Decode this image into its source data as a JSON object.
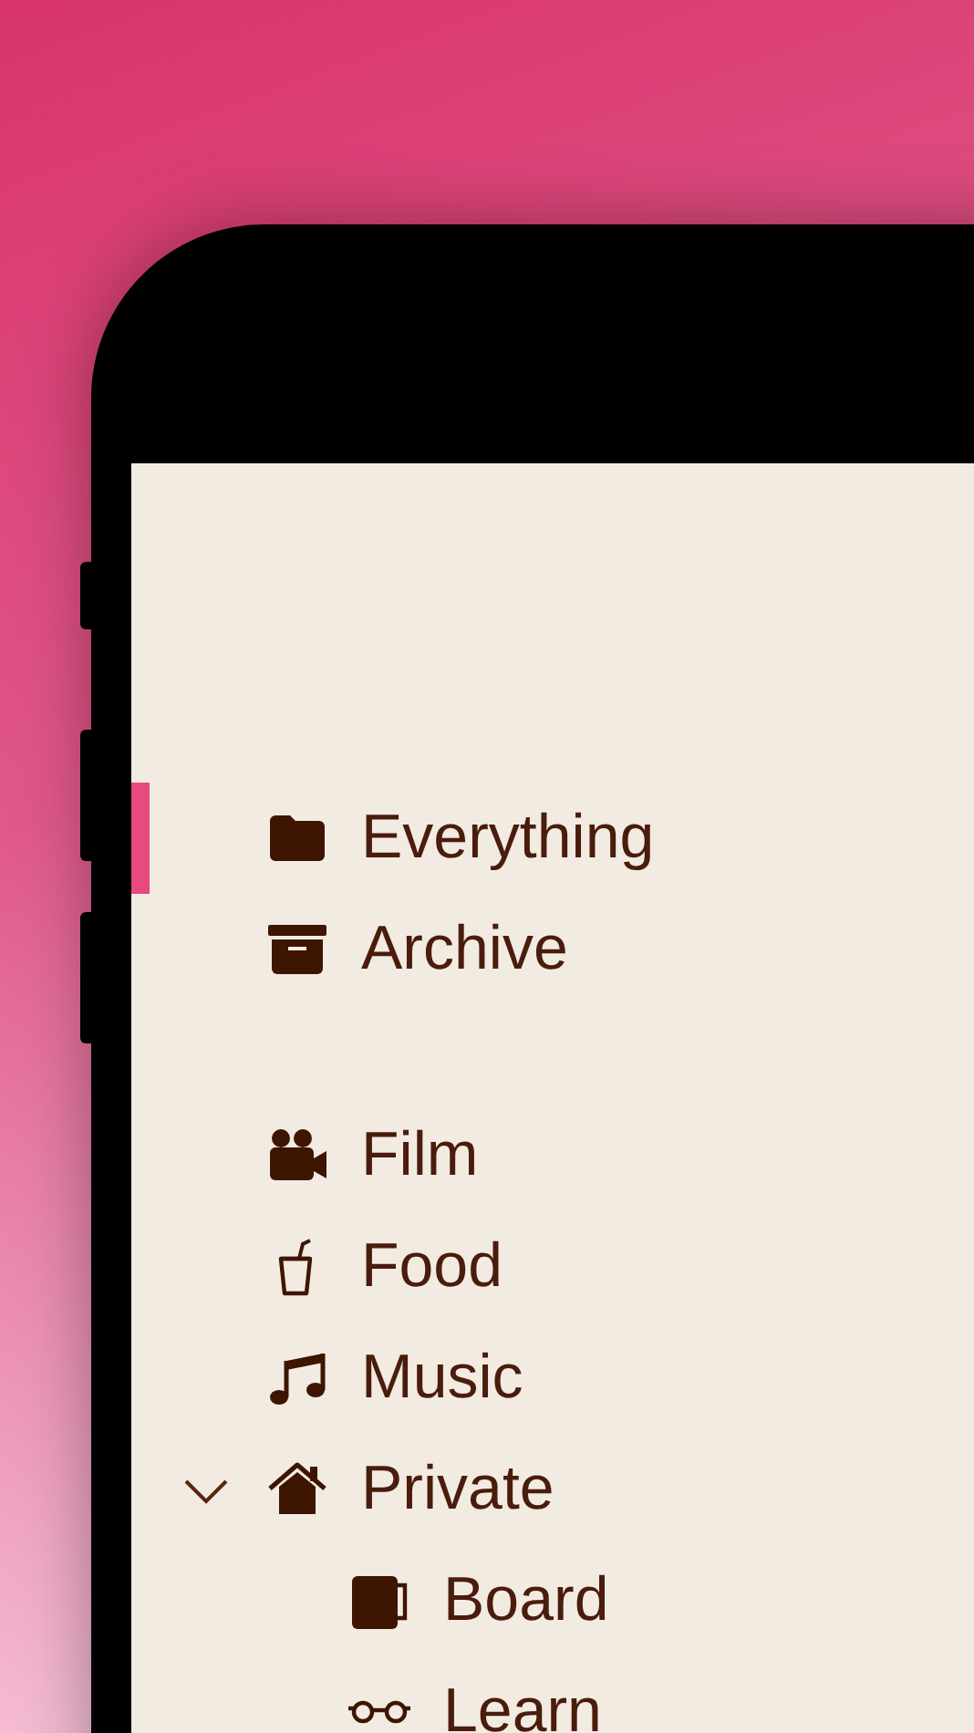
{
  "sections": [
    {
      "items": [
        {
          "label": "Everything",
          "selected": true
        },
        {
          "label": "Archive",
          "selected": false
        }
      ]
    },
    {
      "items": [
        {
          "label": "Film",
          "selected": false
        },
        {
          "label": "Food",
          "selected": false
        },
        {
          "label": "Music",
          "selected": false
        },
        {
          "label": "Private",
          "selected": false,
          "expanded": true,
          "children": [
            {
              "label": "Board",
              "selected": false
            },
            {
              "label": "Learn",
              "selected": false
            }
          ]
        }
      ]
    }
  ]
}
